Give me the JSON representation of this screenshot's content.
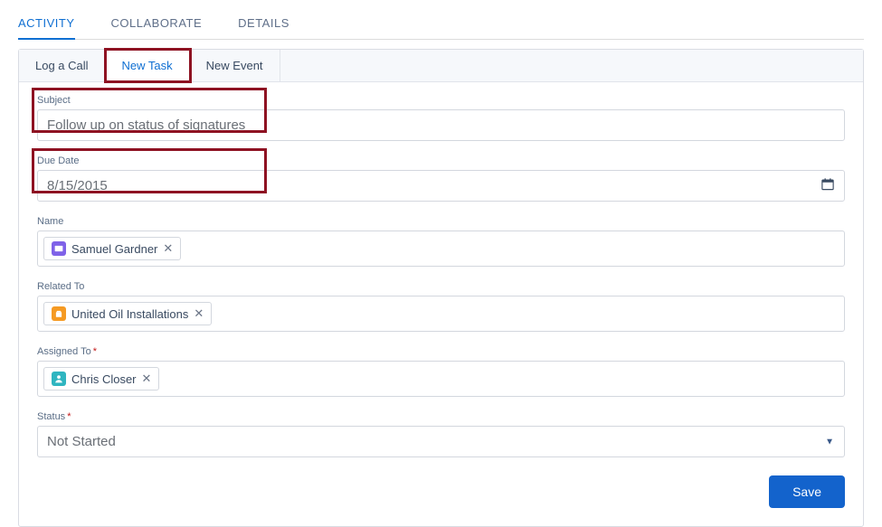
{
  "topnav": {
    "items": [
      {
        "label": "ACTIVITY",
        "active": true
      },
      {
        "label": "COLLABORATE",
        "active": false
      },
      {
        "label": "DETAILS",
        "active": false
      }
    ]
  },
  "subtabs": {
    "items": [
      {
        "label": "Log a Call",
        "active": false,
        "highlight": false
      },
      {
        "label": "New Task",
        "active": true,
        "highlight": true
      },
      {
        "label": "New Event",
        "active": false,
        "highlight": false
      }
    ]
  },
  "fields": {
    "subject": {
      "label": "Subject",
      "value": "Follow up on status of signatures",
      "highlight": true
    },
    "dueDate": {
      "label": "Due Date",
      "value": "8/15/2015",
      "highlight": true
    },
    "name": {
      "label": "Name",
      "pill": {
        "text": "Samuel Gardner",
        "iconClass": "icon-contact",
        "iconGlyph": "◧"
      }
    },
    "relatedTo": {
      "label": "Related To",
      "pill": {
        "text": "United Oil Installations",
        "iconClass": "icon-account",
        "iconGlyph": "♛"
      }
    },
    "assignedTo": {
      "label": "Assigned To",
      "required": true,
      "pill": {
        "text": "Chris Closer",
        "iconClass": "icon-user",
        "iconGlyph": "👤"
      }
    },
    "status": {
      "label": "Status",
      "required": true,
      "value": "Not Started"
    }
  },
  "actions": {
    "save": "Save"
  }
}
